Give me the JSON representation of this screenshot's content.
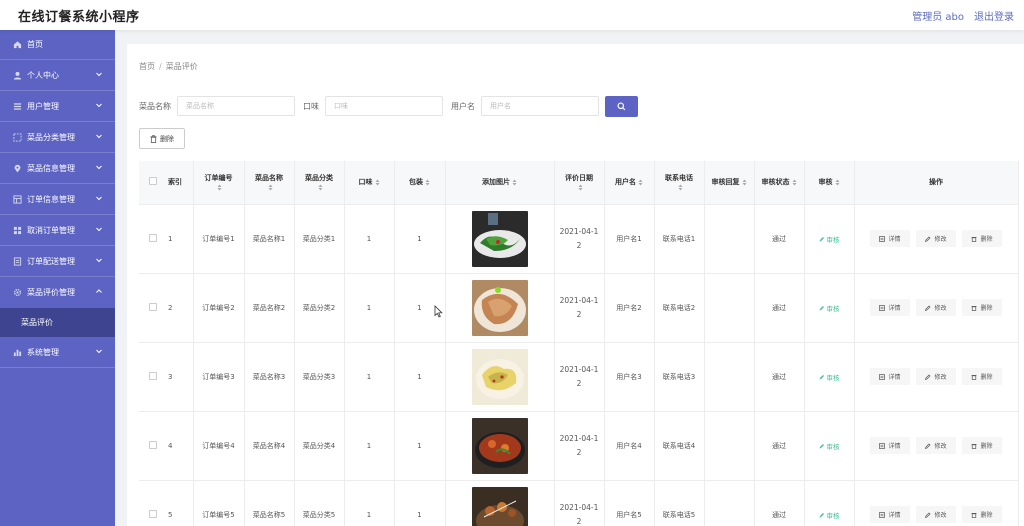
{
  "app": {
    "title": "在线订餐系统小程序",
    "admin_label": "管理员 abo",
    "logout": "退出登录"
  },
  "sidebar": {
    "items": [
      {
        "label": "首页",
        "icon": "home-icon"
      },
      {
        "label": "个人中心",
        "icon": "user-icon"
      },
      {
        "label": "用户管理",
        "icon": "list-icon"
      },
      {
        "label": "菜品分类管理",
        "icon": "dashed-square-icon"
      },
      {
        "label": "菜品信息管理",
        "icon": "pin-icon"
      },
      {
        "label": "订单信息管理",
        "icon": "grid-icon"
      },
      {
        "label": "取消订单管理",
        "icon": "apps-icon"
      },
      {
        "label": "订单配送管理",
        "icon": "doc-icon"
      },
      {
        "label": "菜品评价管理",
        "icon": "gear-icon"
      },
      {
        "label": "系统管理",
        "icon": "chart-icon"
      }
    ],
    "active_sub": "菜品评价"
  },
  "breadcrumb": {
    "home": "首页",
    "sep": "/",
    "current": "菜品评价"
  },
  "search": {
    "name_label": "菜品名称",
    "name_placeholder": "菜品名称",
    "taste_label": "口味",
    "taste_placeholder": "口味",
    "user_label": "用户名",
    "user_placeholder": "用户名"
  },
  "toolbar": {
    "delete_label": "删除"
  },
  "table": {
    "headers": [
      "",
      "索引",
      "订单编号",
      "菜品名称",
      "菜品分类",
      "口味",
      "包装",
      "添加图片",
      "评价日期",
      "用户名",
      "联系电话",
      "审核回复",
      "审核状态",
      "审核",
      "操作"
    ],
    "rows": [
      {
        "index": "1",
        "order_no": "订单编号1",
        "dish": "菜品名称1",
        "category": "菜品分类1",
        "taste": "1",
        "pack": "1",
        "date": "2021-04-12",
        "user": "用户名1",
        "phone": "联系电话1",
        "reply": "",
        "status": "通过",
        "audit": "审核",
        "image": "greens"
      },
      {
        "index": "2",
        "order_no": "订单编号2",
        "dish": "菜品名称2",
        "category": "菜品分类2",
        "taste": "1",
        "pack": "1",
        "date": "2021-04-12",
        "user": "用户名2",
        "phone": "联系电话2",
        "reply": "",
        "status": "通过",
        "audit": "审核",
        "image": "meat"
      },
      {
        "index": "3",
        "order_no": "订单编号3",
        "dish": "菜品名称3",
        "category": "菜品分类3",
        "taste": "1",
        "pack": "1",
        "date": "2021-04-12",
        "user": "用户名3",
        "phone": "联系电话3",
        "reply": "",
        "status": "通过",
        "audit": "审核",
        "image": "cabbage"
      },
      {
        "index": "4",
        "order_no": "订单编号4",
        "dish": "菜品名称4",
        "category": "菜品分类4",
        "taste": "1",
        "pack": "1",
        "date": "2021-04-12",
        "user": "用户名4",
        "phone": "联系电话4",
        "reply": "",
        "status": "通过",
        "audit": "审核",
        "image": "stew"
      },
      {
        "index": "5",
        "order_no": "订单编号5",
        "dish": "菜品名称5",
        "category": "菜品分类5",
        "taste": "1",
        "pack": "1",
        "date": "2021-04-12",
        "user": "用户名5",
        "phone": "联系电话5",
        "reply": "",
        "status": "通过",
        "audit": "审核",
        "image": "skewers"
      }
    ],
    "actions": {
      "detail": "详情",
      "edit": "修改",
      "delete": "删除"
    }
  }
}
